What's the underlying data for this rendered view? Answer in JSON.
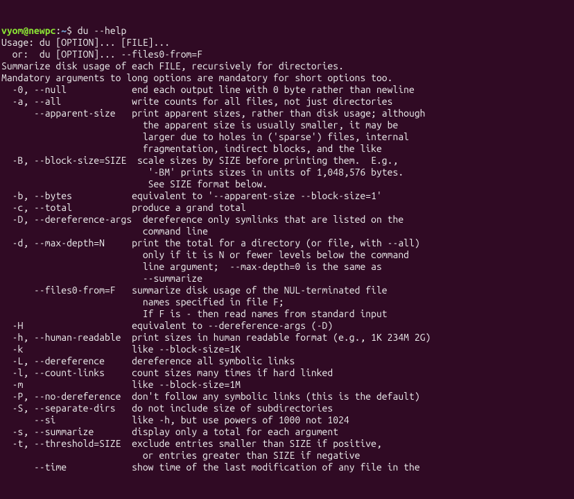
{
  "prompt": {
    "user_host": "vyom@newpc",
    "colon": ":",
    "path": "~",
    "dollar": "$ ",
    "command": "du --help"
  },
  "lines": [
    "Usage: du [OPTION]... [FILE]...",
    "  or:  du [OPTION]... --files0-from=F",
    "Summarize disk usage of each FILE, recursively for directories.",
    "",
    "Mandatory arguments to long options are mandatory for short options too.",
    "  -0, --null            end each output line with 0 byte rather than newline",
    "  -a, --all             write counts for all files, not just directories",
    "      --apparent-size   print apparent sizes, rather than disk usage; although",
    "                          the apparent size is usually smaller, it may be",
    "                          larger due to holes in ('sparse') files, internal",
    "                          fragmentation, indirect blocks, and the like",
    "  -B, --block-size=SIZE  scale sizes by SIZE before printing them.  E.g.,",
    "                           '-BM' prints sizes in units of 1,048,576 bytes.",
    "                           See SIZE format below.",
    "  -b, --bytes           equivalent to '--apparent-size --block-size=1'",
    "  -c, --total           produce a grand total",
    "  -D, --dereference-args  dereference only symlinks that are listed on the",
    "                          command line",
    "  -d, --max-depth=N     print the total for a directory (or file, with --all)",
    "                          only if it is N or fewer levels below the command",
    "                          line argument;  --max-depth=0 is the same as",
    "                          --summarize",
    "      --files0-from=F   summarize disk usage of the NUL-terminated file",
    "                          names specified in file F;",
    "                          If F is - then read names from standard input",
    "  -H                    equivalent to --dereference-args (-D)",
    "  -h, --human-readable  print sizes in human readable format (e.g., 1K 234M 2G)",
    "  -k                    like --block-size=1K",
    "  -L, --dereference     dereference all symbolic links",
    "  -l, --count-links     count sizes many times if hard linked",
    "  -m                    like --block-size=1M",
    "  -P, --no-dereference  don't follow any symbolic links (this is the default)",
    "  -S, --separate-dirs   do not include size of subdirectories",
    "      --si              like -h, but use powers of 1000 not 1024",
    "  -s, --summarize       display only a total for each argument",
    "  -t, --threshold=SIZE  exclude entries smaller than SIZE if positive,",
    "                          or entries greater than SIZE if negative",
    "      --time            show time of the last modification of any file in the"
  ]
}
